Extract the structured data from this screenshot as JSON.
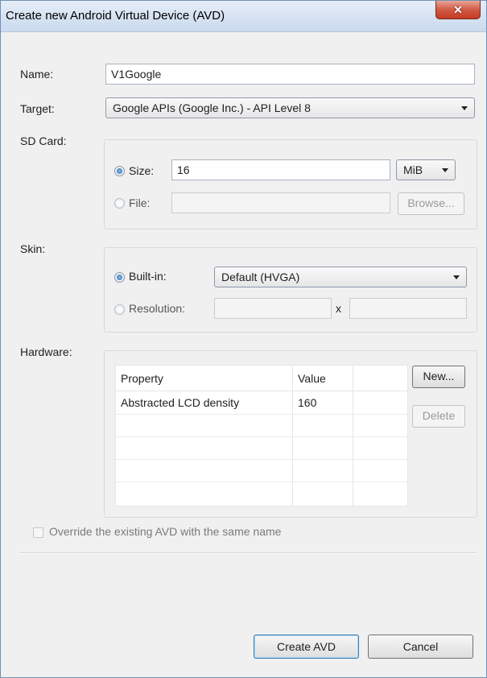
{
  "window": {
    "title": "Create new Android Virtual Device (AVD)",
    "close_symbol": "✕"
  },
  "name": {
    "label": "Name:",
    "value": "V1Google"
  },
  "target": {
    "label": "Target:",
    "value": "Google APIs (Google Inc.) - API Level 8"
  },
  "sdcard": {
    "label": "SD Card:",
    "size_label": "Size:",
    "size_value": "16",
    "unit": "MiB",
    "file_label": "File:",
    "file_value": "",
    "browse_label": "Browse...",
    "size_selected": true
  },
  "skin": {
    "label": "Skin:",
    "builtin_label": "Built-in:",
    "builtin_value": "Default (HVGA)",
    "resolution_label": "Resolution:",
    "resolution_x_sep": "x",
    "builtin_selected": true
  },
  "hardware": {
    "label": "Hardware:",
    "columns": [
      "Property",
      "Value"
    ],
    "rows": [
      {
        "property": "Abstracted LCD density",
        "value": "160"
      }
    ],
    "new_label": "New...",
    "delete_label": "Delete"
  },
  "override": {
    "label": "Override the existing AVD with the same name",
    "checked": false
  },
  "footer": {
    "create_label": "Create AVD",
    "cancel_label": "Cancel"
  },
  "colors": {
    "title_bar": "#d4e1f2",
    "close_button": "#c53a23",
    "default_button_border": "#3c7fb1"
  }
}
